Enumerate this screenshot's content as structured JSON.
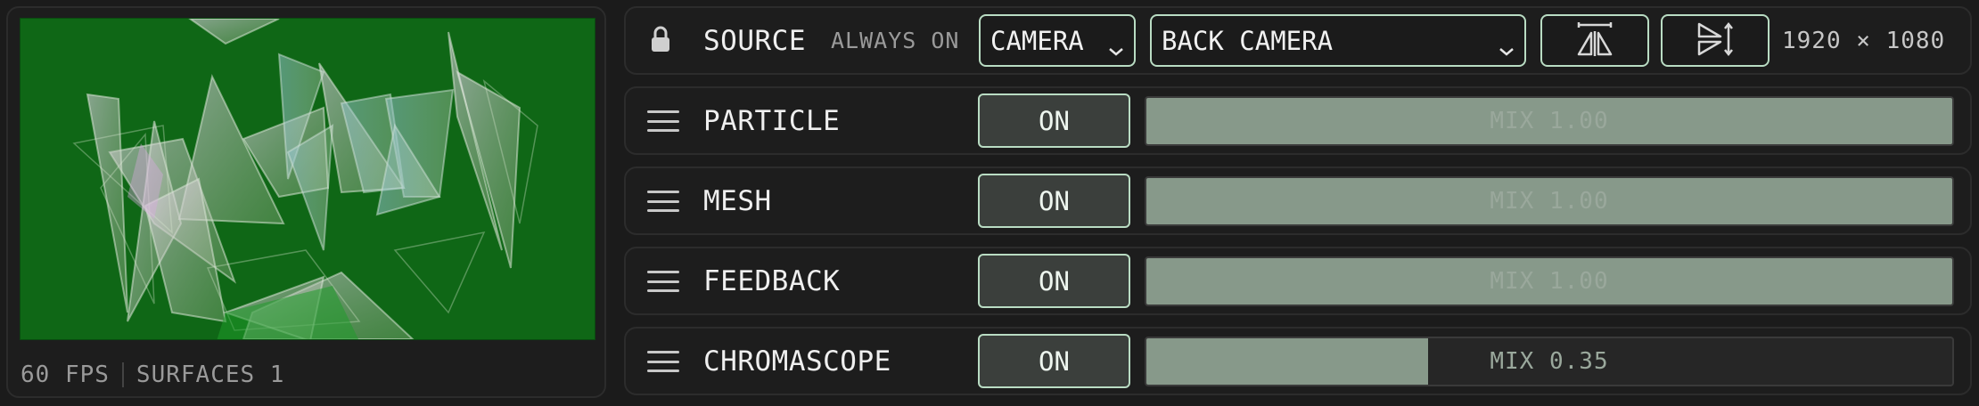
{
  "preview": {
    "stats": {
      "fps": "60 FPS",
      "surfaces": "SURFACES 1"
    },
    "colors": {
      "background": "#0f6716"
    }
  },
  "source": {
    "title": "SOURCE",
    "status": "ALWAYS ON",
    "lock_icon": "lock-icon",
    "input_type": "CAMERA",
    "camera": "BACK CAMERA",
    "flip_horizontal_icon": "flip-horizontal-icon",
    "flip_vertical_icon": "flip-vertical-icon",
    "resolution": "1920 × 1080"
  },
  "layers": [
    {
      "name": "PARTICLE",
      "toggle": "ON",
      "mix_label": "MIX 1.00",
      "mix": 1.0
    },
    {
      "name": "MESH",
      "toggle": "ON",
      "mix_label": "MIX 1.00",
      "mix": 1.0
    },
    {
      "name": "FEEDBACK",
      "toggle": "ON",
      "mix_label": "MIX 1.00",
      "mix": 1.0
    },
    {
      "name": "CHROMASCOPE",
      "toggle": "ON",
      "mix_label": "MIX 0.35",
      "mix": 0.35
    }
  ],
  "theme": {
    "accent_border": "#b9dcc3",
    "slider_fill": "#87998a",
    "panel_bg": "#1d1d1d"
  }
}
